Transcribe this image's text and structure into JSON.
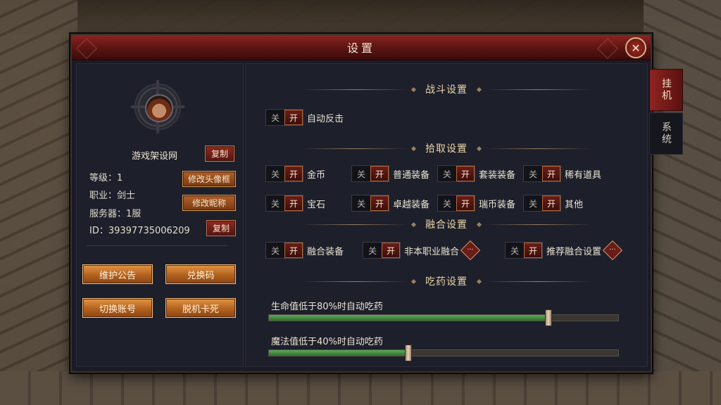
{
  "dialog": {
    "title": "设置"
  },
  "tabs": [
    {
      "label": "挂机",
      "active": true
    },
    {
      "label": "系统",
      "active": false
    }
  ],
  "profile": {
    "name": "游戏架设网",
    "copy_label": "复制",
    "level": "等级：1",
    "job": "职业：剑士",
    "server": "服务器：1服",
    "id": "ID：39397735006209",
    "change_avatar": "修改头像框",
    "change_nick": "修改昵称",
    "copy_id": "复制"
  },
  "actions": {
    "notice": "维护公告",
    "redeem": "兑换码",
    "switch_account": "切换账号",
    "unstuck": "脱机卡死"
  },
  "toggle_labels": {
    "off": "关",
    "on": "开"
  },
  "sections": {
    "combat": {
      "title": "战斗设置",
      "items": [
        {
          "label": "自动反击",
          "on": true
        }
      ]
    },
    "pickup": {
      "title": "拾取设置",
      "items": [
        {
          "label": "金币",
          "on": true
        },
        {
          "label": "普通装备",
          "on": true
        },
        {
          "label": "套装装备",
          "on": true
        },
        {
          "label": "稀有道具",
          "on": true
        },
        {
          "label": "宝石",
          "on": true
        },
        {
          "label": "卓越装备",
          "on": true
        },
        {
          "label": "瑞币装备",
          "on": true
        },
        {
          "label": "其他",
          "on": true
        }
      ]
    },
    "fusion": {
      "title": "融合设置",
      "items": [
        {
          "label": "融合装备",
          "on": true
        },
        {
          "label": "非本职业融合",
          "on": true
        },
        {
          "label": "推荐融合设置",
          "on": true
        }
      ],
      "more_glyph": "···"
    },
    "potion": {
      "title": "吃药设置",
      "hp_label": "生命值低于80%时自动吃药",
      "hp_value": 80,
      "mp_label": "魔法值低于40%时自动吃药",
      "mp_value": 40
    }
  },
  "icons": {
    "close": "close-icon",
    "avatar": "hero-portrait",
    "more": "more-options-icon"
  },
  "colors": {
    "accent_red": "#5a1412",
    "button_orange": "#b3611f",
    "slider_green": "#3f8a3a"
  }
}
